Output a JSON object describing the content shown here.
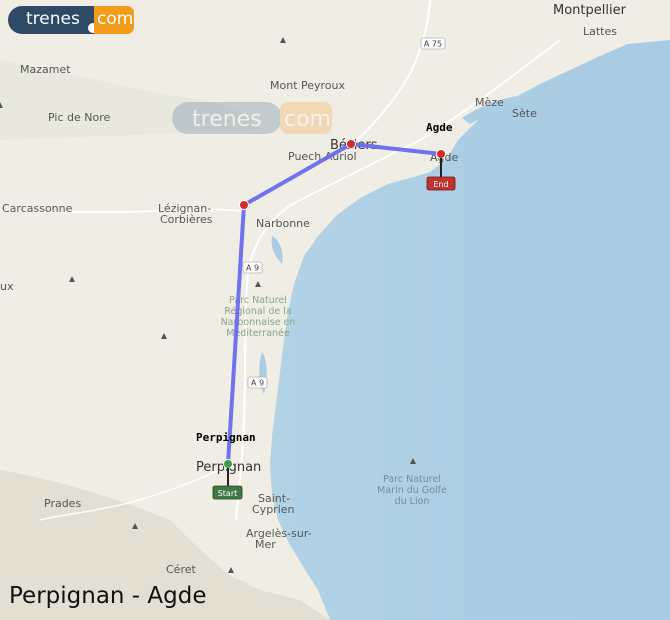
{
  "logo": {
    "brand": "trenes",
    "suffix": "com"
  },
  "watermark": {
    "brand": "trenes",
    "suffix": "com"
  },
  "route_title": "Perpignan - Agde",
  "stops": {
    "origin": "Perpignan",
    "destination": "Agde"
  },
  "markers": {
    "start": "Start",
    "end": "End"
  },
  "places": {
    "montpellier": "Montpellier",
    "lattes": "Lattes",
    "mazamet": "Mazamet",
    "mont_peyroux": "Mont Peyroux",
    "pic_de_nore": "Pic de Nore",
    "meze": "Mèze",
    "sete": "Sète",
    "beziers": "Béziers",
    "puech_aurio": "Puech Auriol",
    "agde": "Agde",
    "carcassonne": "Carcassonne",
    "lezignan_1": "Lézignan-",
    "lezignan_2": "Corbières",
    "narbonne": "Narbonne",
    "perpignan": "Perpignan",
    "prades": "Prades",
    "saint_cyprien_1": "Saint-",
    "saint_cyprien_2": "Cyprien",
    "argeles_1": "Argelès-sur-",
    "argeles_2": "Mer",
    "ceret": "Céret",
    "ux": "ux"
  },
  "park": [
    "Parc Naturel",
    "Régional de la",
    "Narbonnaise en",
    "Méditerranée"
  ],
  "sea_park": [
    "Parc Naturel",
    "Marin du Golfe",
    "du Lion"
  ],
  "roads": {
    "a75": "A 75",
    "a9_top": "A 9",
    "a9_bottom": "A 9"
  },
  "colors": {
    "land": "#efede4",
    "sea": "#aacde3",
    "route": "#6a6af0",
    "stop": "#d42b2b",
    "start_marker": "#3f7a45",
    "end_marker": "#c0342f",
    "brand_dark": "#2f4a66",
    "brand_orange": "#f39c1a"
  }
}
